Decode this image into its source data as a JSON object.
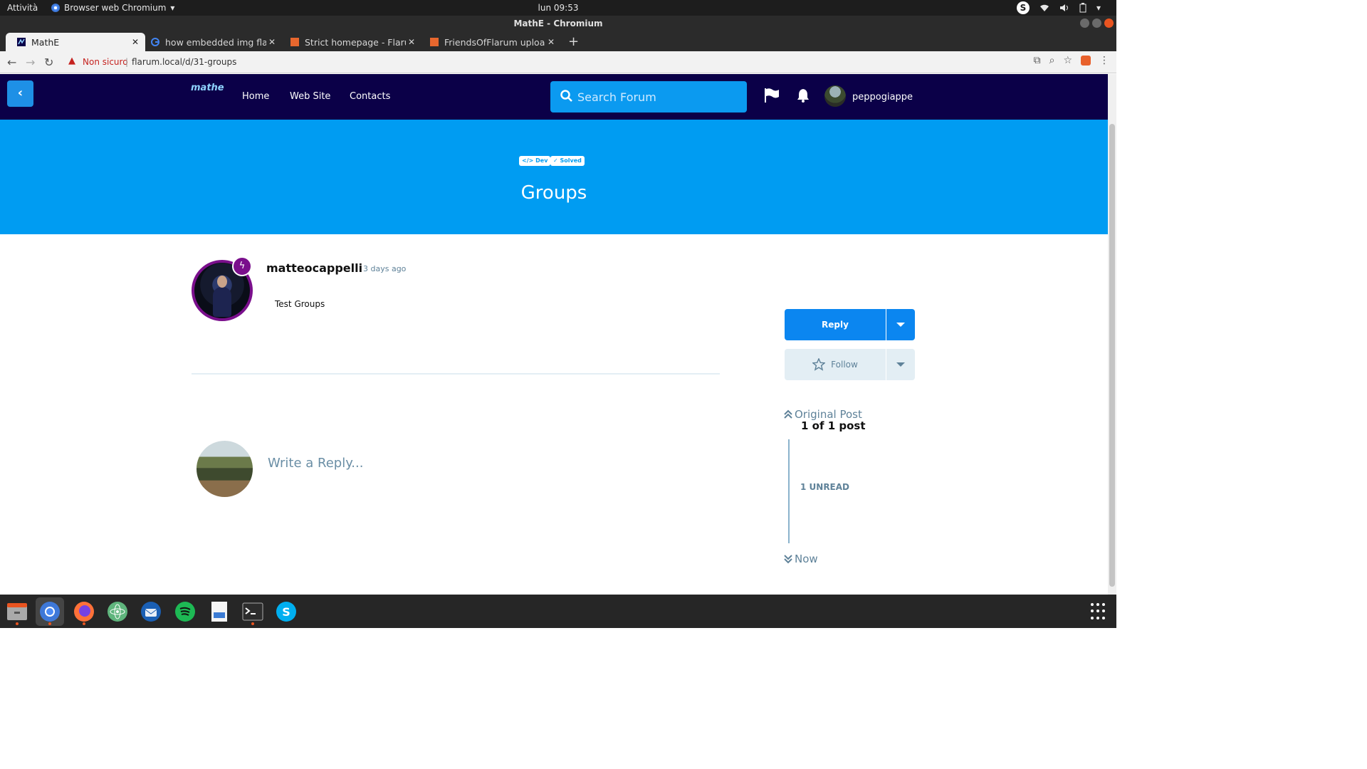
{
  "system_bar": {
    "activities": "Attività",
    "app_menu": "Browser web Chromium",
    "clock": "lun 09:53",
    "tray_icons": [
      "skype-icon",
      "wifi-icon",
      "volume-icon",
      "battery-icon",
      "chevron-down-icon"
    ]
  },
  "window": {
    "title": "MathE - Chromium"
  },
  "tabs": [
    {
      "title": "MathE",
      "favicon": "mathe-favicon",
      "active": true
    },
    {
      "title": "how embedded img flarum",
      "favicon": "google-favicon",
      "active": false
    },
    {
      "title": "Strict homepage - Flarum",
      "favicon": "flarum-favicon",
      "active": false
    },
    {
      "title": "FriendsOfFlarum upload,",
      "favicon": "flarum-favicon",
      "active": false
    }
  ],
  "address_bar": {
    "security_label": "Non sicuro",
    "url": "flarum.local/d/31-groups"
  },
  "forum": {
    "nav": {
      "home": "Home",
      "website": "Web Site",
      "contacts": "Contacts"
    },
    "logo_text": "mathe",
    "search_placeholder": "Search Forum",
    "username": "peppogiappe"
  },
  "discussion": {
    "tags": [
      {
        "icon": "code-icon",
        "label": "Dev"
      },
      {
        "icon": "check-icon",
        "label": "Solved"
      }
    ],
    "title": "Groups",
    "post": {
      "author": "matteocappelli",
      "time": "3 days ago",
      "body": "Test Groups",
      "badge_icon": "bolt-icon"
    },
    "reply_placeholder": "Write a Reply..."
  },
  "sidebar": {
    "reply_label": "Reply",
    "follow_label": "Follow",
    "original_post": "Original Post",
    "position": "1 of 1 post",
    "unread": "1 UNREAD",
    "now": "Now"
  },
  "dock": {
    "apps": [
      "files-icon",
      "chromium-icon",
      "firefox-icon",
      "atom-icon",
      "thunderbird-icon",
      "spotify-icon",
      "document-viewer-icon",
      "terminal-icon",
      "skype-icon"
    ]
  },
  "colors": {
    "header_bg": "#0b0048",
    "hero_bg": "#009cf2",
    "primary_button": "#0b86f0",
    "group_badge": "#7a0f8c",
    "muted_text": "#5f8299"
  }
}
